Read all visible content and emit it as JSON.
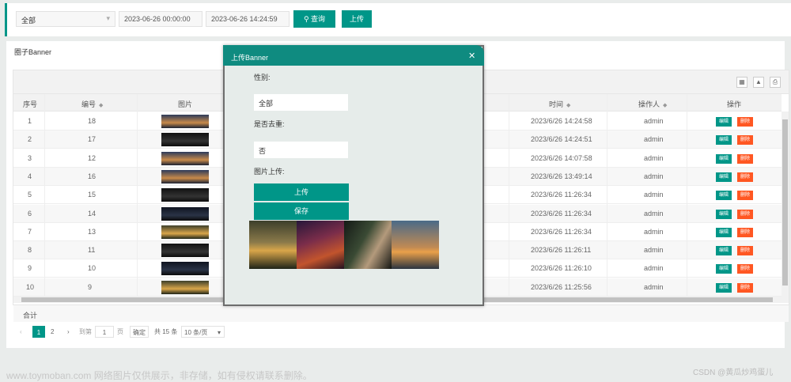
{
  "filters": {
    "gender_select": "全部",
    "start_time": "2023-06-26 00:00:00",
    "end_time": "2023-06-26 14:24:59",
    "search_label": "查询",
    "upload_label": "上传"
  },
  "panel": {
    "title": "圈子Banner",
    "total_label": "合计"
  },
  "table": {
    "headers": [
      "序号",
      "编号",
      "图片",
      "时间",
      "操作人",
      "操作"
    ],
    "edit_label": "编辑",
    "delete_label": "删除",
    "rows": [
      {
        "seq": "1",
        "id": "18",
        "time": "2023/6/26 14:24:58",
        "operator": "admin"
      },
      {
        "seq": "2",
        "id": "17",
        "time": "2023/6/26 14:24:51",
        "operator": "admin"
      },
      {
        "seq": "3",
        "id": "12",
        "time": "2023/6/26 14:07:58",
        "operator": "admin"
      },
      {
        "seq": "4",
        "id": "16",
        "time": "2023/6/26 13:49:14",
        "operator": "admin"
      },
      {
        "seq": "5",
        "id": "15",
        "time": "2023/6/26 11:26:34",
        "operator": "admin"
      },
      {
        "seq": "6",
        "id": "14",
        "time": "2023/6/26 11:26:34",
        "operator": "admin"
      },
      {
        "seq": "7",
        "id": "13",
        "time": "2023/6/26 11:26:34",
        "operator": "admin"
      },
      {
        "seq": "8",
        "id": "11",
        "time": "2023/6/26 11:26:11",
        "operator": "admin"
      },
      {
        "seq": "9",
        "id": "10",
        "time": "2023/6/26 11:26:10",
        "operator": "admin"
      },
      {
        "seq": "10",
        "id": "9",
        "time": "2023/6/26 11:25:56",
        "operator": "admin"
      }
    ]
  },
  "pager": {
    "prev": "‹",
    "page1": "1",
    "page2": "2",
    "next": "›",
    "goto_label": "到第",
    "goto_value": "1",
    "page_unit": "页",
    "confirm": "确定",
    "total": "共 15 条",
    "per_page": "10 条/页"
  },
  "modal": {
    "title": "上传Banner",
    "close": "✕",
    "gender_label": "性别:",
    "gender_value": "全部",
    "dedupe_label": "是否去重:",
    "dedupe_value": "否",
    "image_upload_label": "图片上传:",
    "upload_btn": "上传",
    "save_btn": "保存"
  },
  "watermark": {
    "left": "www.toymoban.com 网络图片仅供展示，非存储，如有侵权请联系删除。",
    "right": "CSDN @黄瓜炒鸡蛋儿"
  },
  "colors": {
    "accent": "#009688",
    "danger": "#ff5722",
    "modal_header": "#0f8b80"
  }
}
